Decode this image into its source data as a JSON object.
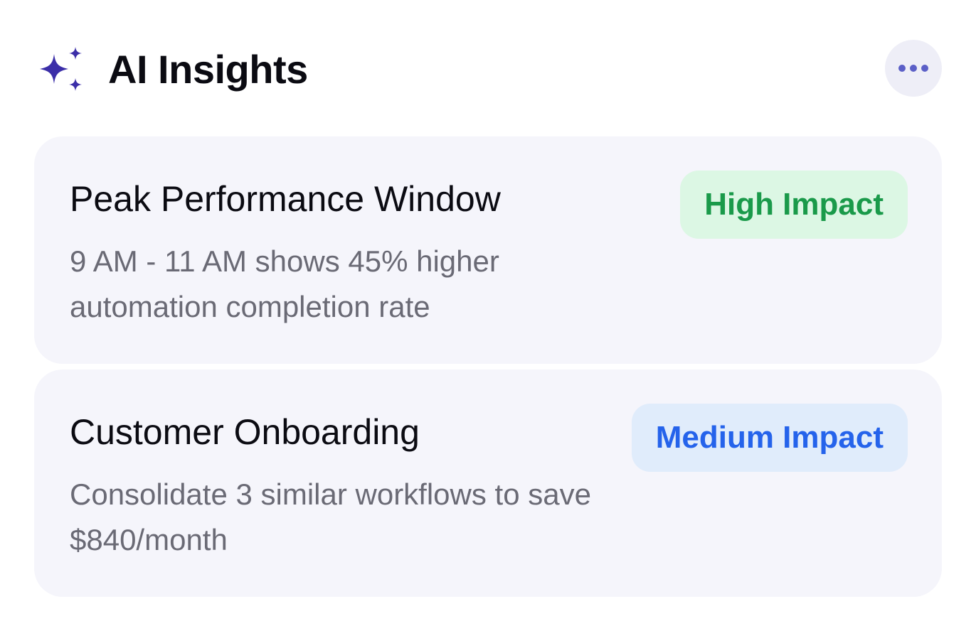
{
  "header": {
    "title": "AI Insights",
    "icon": "sparkles-icon",
    "more_icon": "more-horizontal-icon",
    "accent_color": "#3b2ea8"
  },
  "insights": [
    {
      "title": "Peak Performance Window",
      "description": "9 AM - 11 AM shows 45% higher automation completion rate",
      "badge": "High Impact",
      "badge_color": "#1a9a4a",
      "badge_bg": "#dcf7e4"
    },
    {
      "title": "Customer Onboarding",
      "description": "Consolidate 3 similar workflows to save $840/month",
      "badge": "Medium Impact",
      "badge_color": "#2563eb",
      "badge_bg": "#e0ecfb"
    }
  ]
}
